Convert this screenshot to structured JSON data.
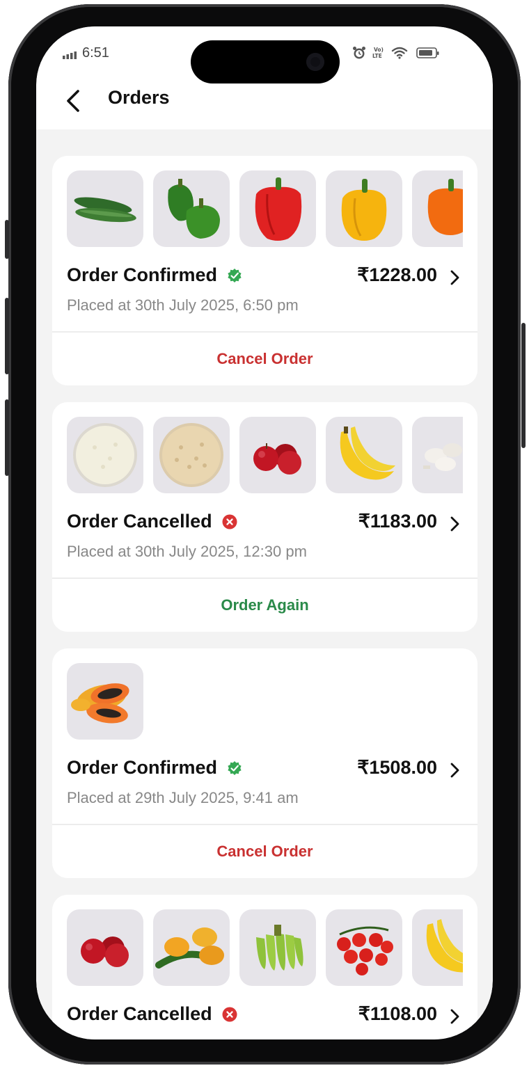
{
  "status_bar": {
    "time": "6:51",
    "icons": [
      "signal-bars-icon",
      "alarm-icon",
      "volte-lte-icon",
      "wifi-icon",
      "battery-icon"
    ]
  },
  "header": {
    "back_icon": "chevron-left-icon",
    "title": "Orders"
  },
  "colors": {
    "confirmed": "#34a853",
    "cancelled": "#d93434",
    "cancel_action": "#c93131",
    "again_action": "#2a8a49",
    "thumb_bg": "#e6e4e9"
  },
  "orders": [
    {
      "status": "Order Confirmed",
      "status_icon": "check-badge-icon",
      "price": "₹1228.00",
      "placed": "Placed at 30th July 2025, 6:50 pm",
      "action": "Cancel Order",
      "items": [
        "cucumber",
        "green-capsicum",
        "red-capsicum",
        "yellow-capsicum",
        "orange-capsicum"
      ]
    },
    {
      "status": "Order Cancelled",
      "status_icon": "cancel-badge-icon",
      "price": "₹1183.00",
      "placed": "Placed at 30th July 2025, 12:30 pm",
      "action": "Order Again",
      "items": [
        "white-rice",
        "brown-rice",
        "red-apples",
        "bananas",
        "mushrooms"
      ]
    },
    {
      "status": "Order Confirmed",
      "status_icon": "check-badge-icon",
      "price": "₹1508.00",
      "placed": "Placed at 29th July 2025, 9:41 am",
      "action": "Cancel Order",
      "items": [
        "papaya"
      ]
    },
    {
      "status": "Order Cancelled",
      "status_icon": "cancel-badge-icon",
      "price": "₹1108.00",
      "placed": "",
      "action": "",
      "items": [
        "red-apples",
        "mangoes",
        "green-bananas",
        "cherry-tomatoes",
        "bananas"
      ]
    }
  ]
}
